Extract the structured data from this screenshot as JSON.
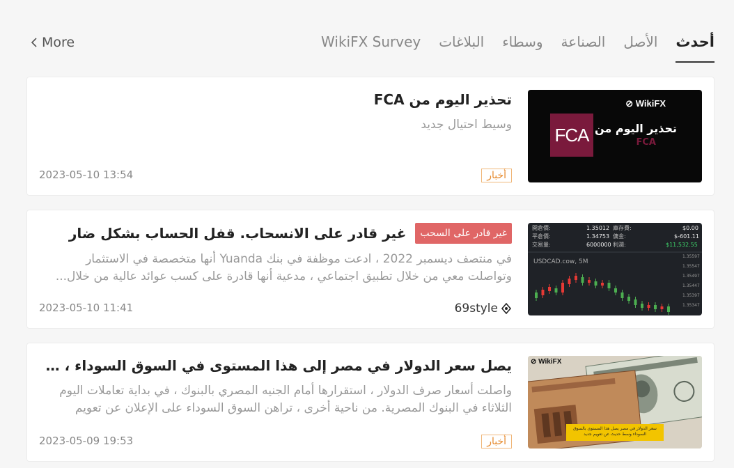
{
  "nav": {
    "more_label": "More",
    "tabs": [
      {
        "label": "أحدث",
        "active": true
      },
      {
        "label": "الأصل",
        "active": false
      },
      {
        "label": "الصناعة",
        "active": false
      },
      {
        "label": "وسطاء",
        "active": false
      },
      {
        "label": "البلاغات",
        "active": false
      },
      {
        "label": "WikiFX Survey",
        "active": false
      }
    ]
  },
  "articles": [
    {
      "title": "تحذير اليوم من FCA",
      "summary": "وسيط احتيال جديد",
      "date": "2023-05-10 13:54",
      "tag": "أخبار",
      "thumb": {
        "logo": "FCA",
        "brand": "WikiFX",
        "title": "تحذير اليوم من",
        "subtitle": "FCA"
      }
    },
    {
      "badge": "غير قادر على السحب",
      "title": "غير قادر على الانسحاب. قفل الحساب بشكل ضار",
      "summary": "في منتصف ديسمبر 2022 ، ادعت موظفة في بنك Yuanda أنها متخصصة في الاستثمار وتواصلت معي من خلال تطبيق اجتماعي ، مدعية أنها قادرة على كسب عوائد عالية من خلال...",
      "date": "2023-05-10 11:41",
      "source": "69style",
      "source_icon": "source-icon",
      "thumb": {
        "pair": "USDCAD.cow, 5M",
        "stats": [
          {
            "label": "開倉價:",
            "value": "1.35012",
            "label2": "庫存費:",
            "value2": "$0.00"
          },
          {
            "label": "平倉價:",
            "value": "1.34753",
            "label2": "傭金:",
            "value2": "$-601.11"
          },
          {
            "label": "交易量:",
            "value": "6000000",
            "label2": "利潤:",
            "value2": "$11,532.55"
          }
        ],
        "prices": [
          "1.35597",
          "1.35547",
          "1.35497",
          "1.35447",
          "1.35397",
          "1.35347"
        ]
      }
    },
    {
      "title": "يصل سعر الدولار في مصر إلى هذا المستوى في السوق السوداء ، وسط حديث عن تعويم جديد",
      "summary": "واصلت أسعار صرف الدولار ، استقرارها أمام الجنيه المصري بالبنوك ، في بداية تعاملات اليوم الثلاثاء في البنوك المصرية. من ناحية أخرى ، تراهن السوق السوداء على الإعلان عن تعويم جديد...",
      "date": "2023-05-09 19:53",
      "tag": "أخبار",
      "thumb": {
        "brand": "WikiFX",
        "caption": "سعر الدولار في مصر يصل هذا المستوى بالسوق السوداء وسط حديث عن تعويم جديد"
      }
    }
  ],
  "colors": {
    "background": "#f6f6f6",
    "card": "#ffffff",
    "badge": "#e06666",
    "tag_border": "#f0b77a",
    "tag_text": "#e68a2e",
    "fca_brand": "#7a1a3c",
    "chart_up": "#4caf50",
    "chart_down": "#e53935"
  }
}
